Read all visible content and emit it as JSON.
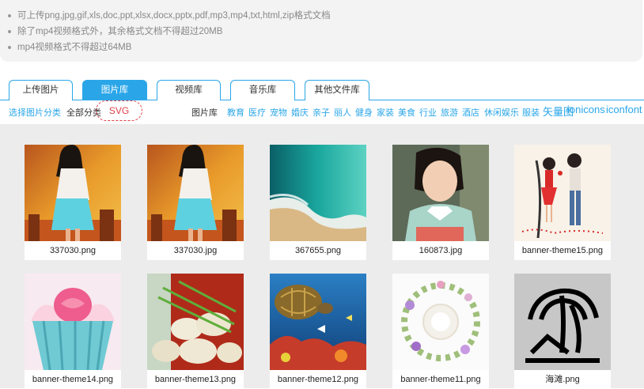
{
  "tips": [
    "可上传png,jpg,gif,xls,doc,ppt,xlsx,docx,pptx,pdf,mp3,mp4,txt,html,zip格式文档",
    "除了mp4视频格式外，其余格式文档不得超过20MB",
    "mp4视频格式不得超过64MB"
  ],
  "tabs": [
    {
      "label": "上传图片"
    },
    {
      "label": "图片库"
    },
    {
      "label": "视频库"
    },
    {
      "label": "音乐库"
    },
    {
      "label": "其他文件库"
    }
  ],
  "categories": {
    "select_label": "选择图片分类",
    "all_label": "全部分类",
    "svg_label": "SVG",
    "library_label": "图片库",
    "items": [
      "教育",
      "医疗",
      "宠物",
      "婚庆",
      "亲子",
      "丽人",
      "健身",
      "家装",
      "美食",
      "行业",
      "旅游",
      "酒店",
      "休闲娱乐",
      "服装"
    ],
    "icon_sets": [
      "矢量图",
      "ionicons",
      "iconfont"
    ]
  },
  "images": [
    {
      "name": "337030.png"
    },
    {
      "name": "337030.jpg"
    },
    {
      "name": "367655.png"
    },
    {
      "name": "160873.jpg"
    },
    {
      "name": "banner-theme15.png"
    },
    {
      "name": "banner-theme14.png"
    },
    {
      "name": "banner-theme13.png"
    },
    {
      "name": "banner-theme12.png"
    },
    {
      "name": "banner-theme11.png"
    },
    {
      "name": "海滩.png"
    }
  ]
}
